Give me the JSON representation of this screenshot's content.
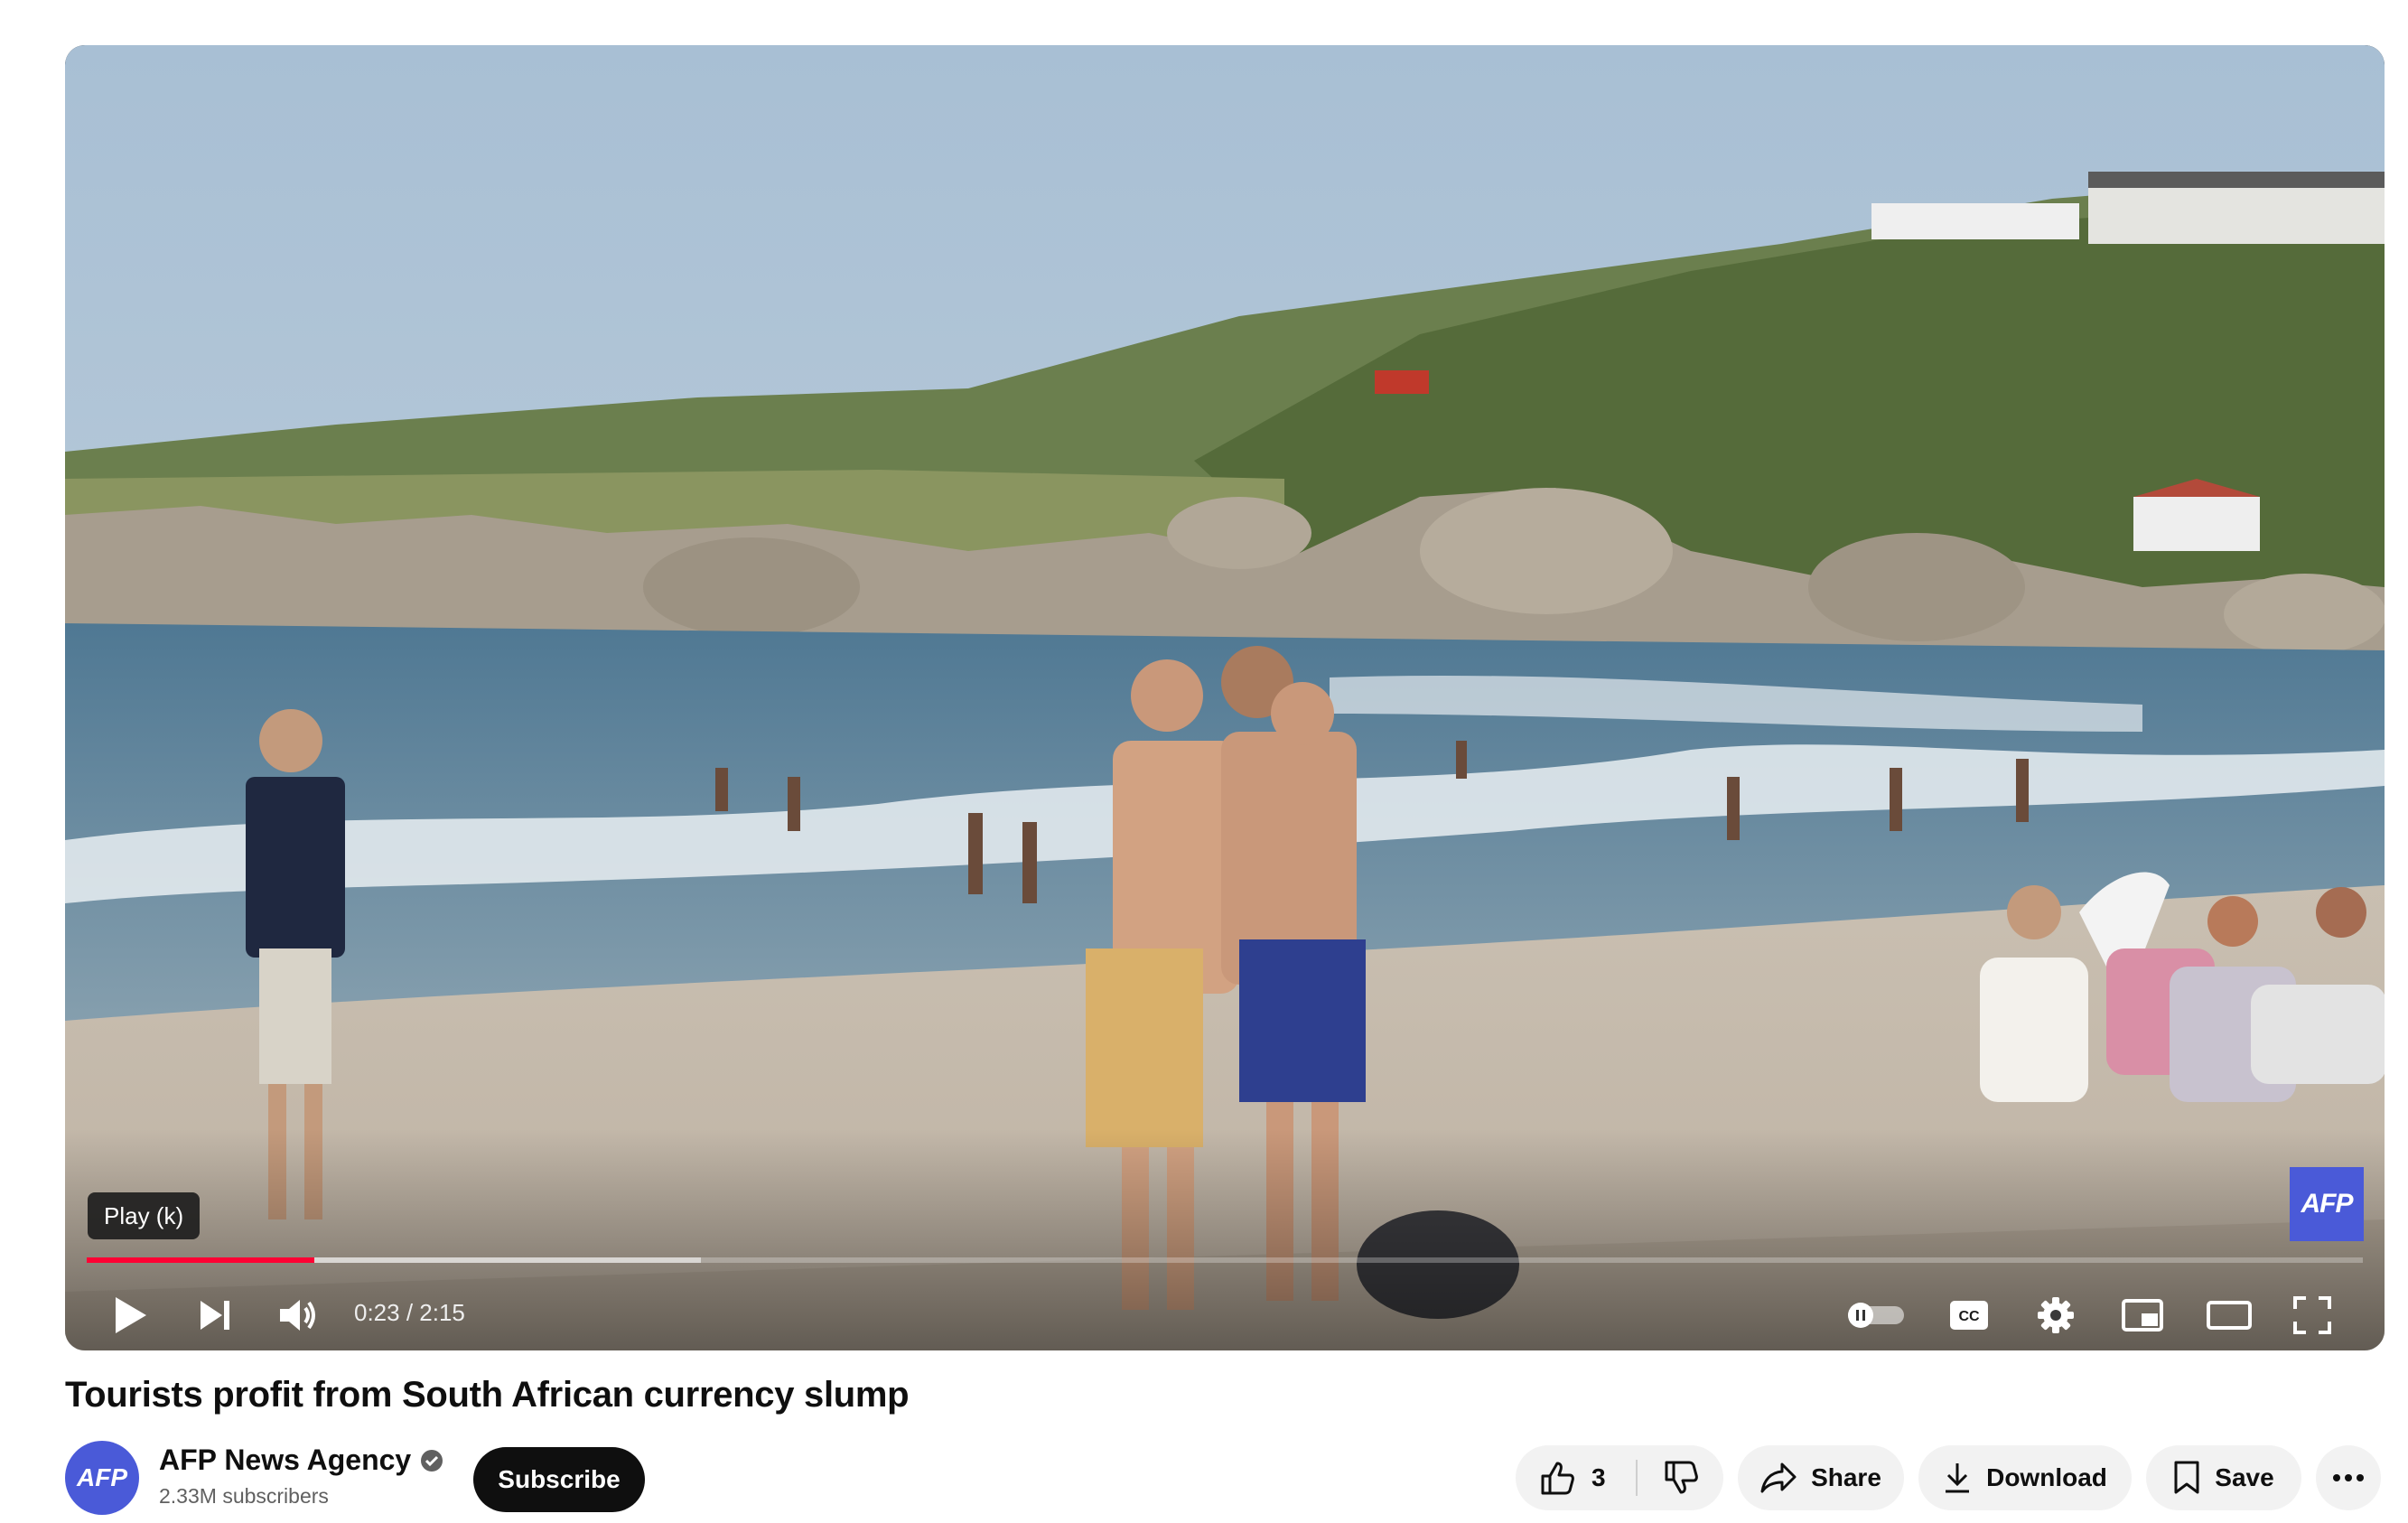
{
  "player": {
    "tooltip": "Play (k)",
    "time_display": "0:23 / 2:15",
    "progress_played_fraction": 0.1,
    "progress_buffered_fraction": 0.27,
    "watermark": "AFP",
    "controls": {
      "play_icon": "play-icon",
      "next_icon": "next-icon",
      "volume_icon": "volume-icon",
      "autoplay_icon": "autoplay-toggle-icon",
      "subtitles_icon": "cc-icon",
      "settings_icon": "gear-icon",
      "miniplayer_icon": "miniplayer-icon",
      "theater_icon": "theater-mode-icon",
      "fullscreen_icon": "fullscreen-icon"
    }
  },
  "video": {
    "title": "Tourists profit from South African currency slump"
  },
  "channel": {
    "avatar_text": "AFP",
    "name": "AFP News Agency",
    "verified_icon": "verified-check-icon",
    "subscribers": "2.33M subscribers",
    "subscribe_label": "Subscribe"
  },
  "actions": {
    "like_count": "3",
    "share_label": "Share",
    "download_label": "Download",
    "save_label": "Save",
    "more_icon": "more-horizontal-icon"
  },
  "colors": {
    "progress_red": "#ff0033",
    "afp_blue": "#4a5ad8",
    "pill_bg": "#f2f2f2"
  }
}
